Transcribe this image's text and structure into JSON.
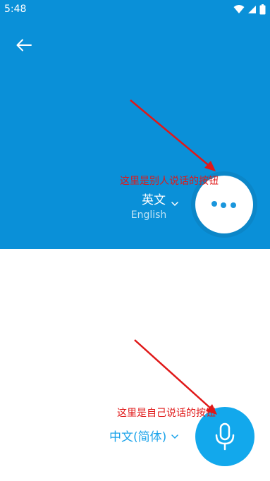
{
  "status_bar": {
    "time": "5:48",
    "icons": [
      "wifi-icon",
      "signal-icon",
      "battery-icon"
    ]
  },
  "header": {
    "back_icon": "back-arrow-icon"
  },
  "other_speaker": {
    "language_primary": "英文",
    "language_secondary": "English",
    "chevron_icon": "chevron-down-icon",
    "button_icon": "more-dots-icon",
    "annotation": "这里是别人说话的按钮"
  },
  "self_speaker": {
    "language": "中文(简体)",
    "chevron_icon": "chevron-down-icon",
    "button_icon": "microphone-icon",
    "annotation": "这里是自己说话的按钮"
  },
  "colors": {
    "panel_blue": "#0a90d8",
    "button_ring": "#0b86c8",
    "mic_blue": "#12a8ec",
    "language_blue": "#1aa3ea",
    "annotation_red": "#e01818"
  }
}
